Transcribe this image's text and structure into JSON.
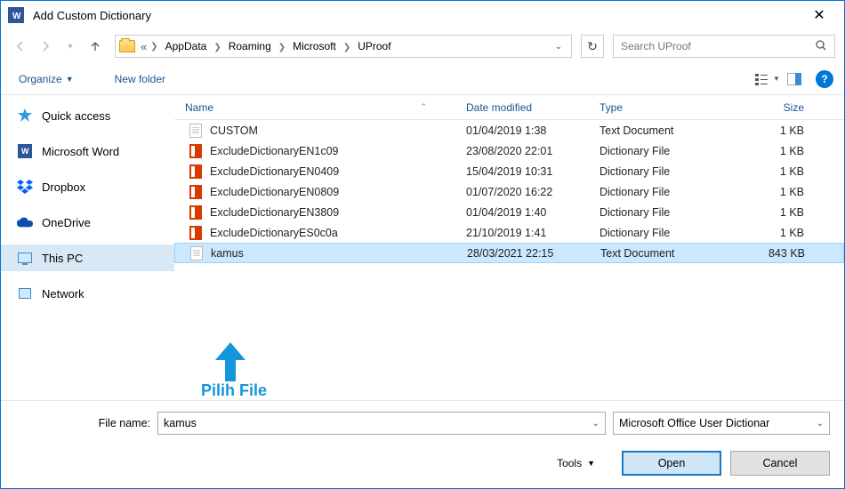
{
  "title": "Add Custom Dictionary",
  "breadcrumb": {
    "prefix": "«",
    "segments": [
      "AppData",
      "Roaming",
      "Microsoft",
      "UProof"
    ]
  },
  "search": {
    "placeholder": "Search UProof"
  },
  "toolbar": {
    "organize": "Organize",
    "newfolder": "New folder"
  },
  "sidebar": {
    "items": [
      {
        "label": "Quick access",
        "icon": "star"
      },
      {
        "label": "Microsoft Word",
        "icon": "word"
      },
      {
        "label": "Dropbox",
        "icon": "dropbox"
      },
      {
        "label": "OneDrive",
        "icon": "onedrive"
      },
      {
        "label": "This PC",
        "icon": "pc",
        "selected": true
      },
      {
        "label": "Network",
        "icon": "network"
      }
    ]
  },
  "columns": {
    "name": "Name",
    "date": "Date modified",
    "type": "Type",
    "size": "Size"
  },
  "files": [
    {
      "name": "CUSTOM",
      "date": "01/04/2019 1:38",
      "type": "Text Document",
      "size": "1 KB",
      "icon": "txt",
      "selected": false
    },
    {
      "name": "ExcludeDictionaryEN1c09",
      "date": "23/08/2020 22:01",
      "type": "Dictionary File",
      "size": "1 KB",
      "icon": "office",
      "selected": false
    },
    {
      "name": "ExcludeDictionaryEN0409",
      "date": "15/04/2019 10:31",
      "type": "Dictionary File",
      "size": "1 KB",
      "icon": "office",
      "selected": false
    },
    {
      "name": "ExcludeDictionaryEN0809",
      "date": "01/07/2020 16:22",
      "type": "Dictionary File",
      "size": "1 KB",
      "icon": "office",
      "selected": false
    },
    {
      "name": "ExcludeDictionaryEN3809",
      "date": "01/04/2019 1:40",
      "type": "Dictionary File",
      "size": "1 KB",
      "icon": "office",
      "selected": false
    },
    {
      "name": "ExcludeDictionaryES0c0a",
      "date": "21/10/2019 1:41",
      "type": "Dictionary File",
      "size": "1 KB",
      "icon": "office",
      "selected": false
    },
    {
      "name": "kamus",
      "date": "28/03/2021 22:15",
      "type": "Text Document",
      "size": "843 KB",
      "icon": "txt",
      "selected": true
    }
  ],
  "annotation": "Pilih File",
  "bottom": {
    "filename_label": "File name:",
    "filename_value": "kamus",
    "filter": "Microsoft Office User Dictionar",
    "tools": "Tools",
    "open": "Open",
    "cancel": "Cancel"
  }
}
